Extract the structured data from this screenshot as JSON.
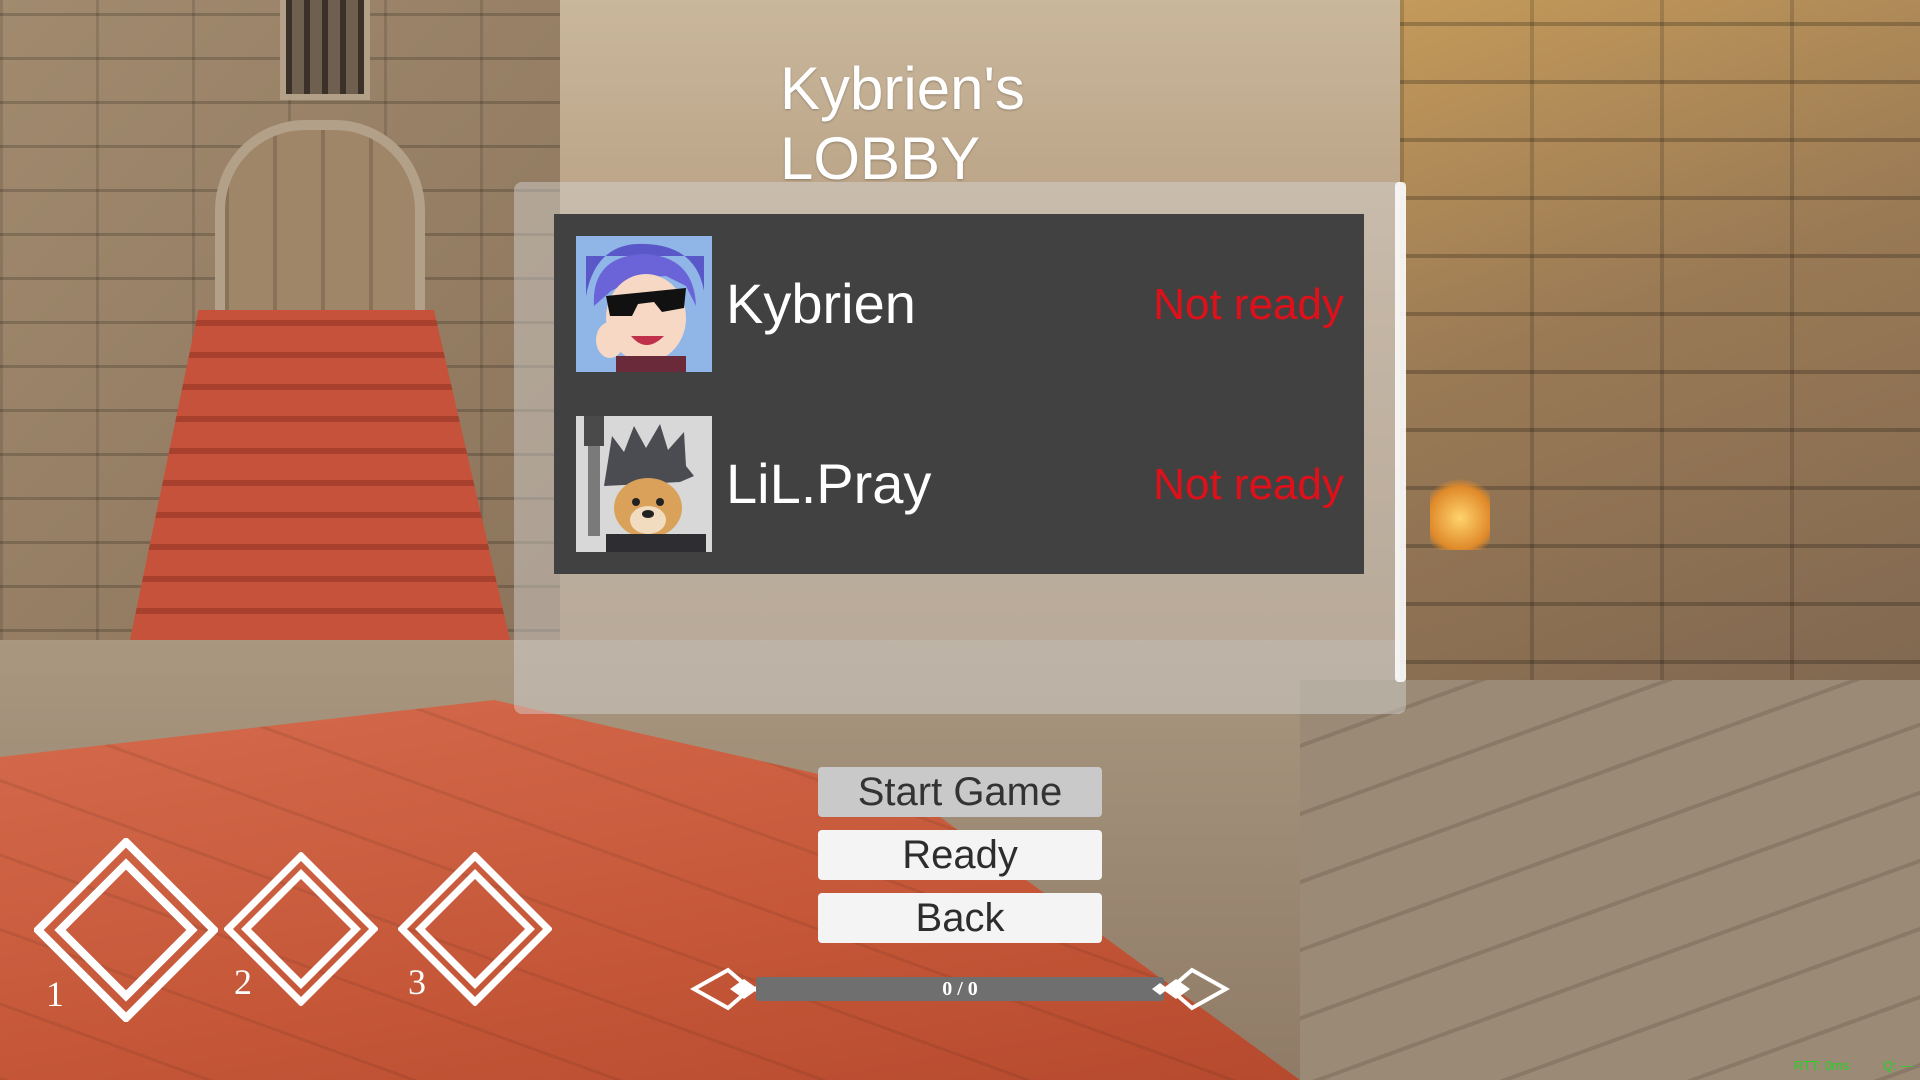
{
  "lobby": {
    "title_line1": "Kybrien's",
    "title_line2": "LOBBY",
    "players": [
      {
        "name": "Kybrien",
        "status": "Not ready",
        "avatar": "anime-sunglasses-avatar"
      },
      {
        "name": "LiL.Pray",
        "status": "Not ready",
        "avatar": "doge-warrior-avatar"
      }
    ]
  },
  "buttons": {
    "start_game": "Start Game",
    "ready": "Ready",
    "back": "Back"
  },
  "progress": {
    "text": "0 / 0",
    "current": 0,
    "total": 0
  },
  "ability_slots": [
    {
      "number": "1",
      "icon": "diamond-icon"
    },
    {
      "number": "2",
      "icon": "diamond-icon"
    },
    {
      "number": "3",
      "icon": "diamond-icon"
    }
  ],
  "debug": {
    "rtt": "RTT: 0ms",
    "q": "Q: ---"
  },
  "colors": {
    "status_not_ready": "#e0101a",
    "panel_bg": "#414141",
    "debug_text": "#22d322"
  }
}
